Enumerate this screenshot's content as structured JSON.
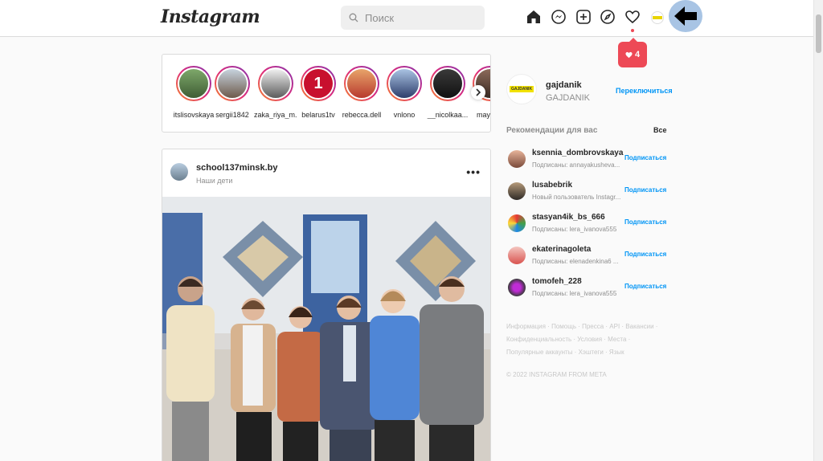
{
  "header": {
    "logo": "Instagram",
    "search_placeholder": "Поиск",
    "notifications": {
      "count": "4"
    }
  },
  "icons": {
    "home": "home-icon",
    "messenger": "messenger-icon",
    "new_post": "plus-square-icon",
    "explore": "compass-icon",
    "activity": "heart-icon",
    "arrow": "arrow-left-icon"
  },
  "stories": [
    {
      "name": "itslisovskaya"
    },
    {
      "name": "sergii1842"
    },
    {
      "name": "zaka_riya_m..."
    },
    {
      "name": "belarus1tv"
    },
    {
      "name": "rebecca.dell"
    },
    {
      "name": "vnlono"
    },
    {
      "name": "__nicolkaa..."
    },
    {
      "name": "mayos..."
    }
  ],
  "post": {
    "username": "school137minsk.by",
    "location": "Наши дети",
    "more": "•••"
  },
  "sidebar": {
    "me": {
      "username": "gajdanik",
      "full_name": "GAJDANIK",
      "avatar_text": "GAJDANIK",
      "switch_label": "Переключиться"
    },
    "suggestions_title": "Рекомендации для вас",
    "see_all": "Все",
    "suggestions": [
      {
        "username": "ksennia_dombrovskaya",
        "sub": "Подписаны: annayakusheva...",
        "follow": "Подписаться"
      },
      {
        "username": "lusabebrik",
        "sub": "Новый пользователь Instagr...",
        "follow": "Подписаться"
      },
      {
        "username": "stasyan4ik_bs_666",
        "sub": "Подписаны: lera_ivanova555",
        "follow": "Подписаться"
      },
      {
        "username": "ekaterinagoleta",
        "sub": "Подписаны: elenadenkina6 ...",
        "follow": "Подписаться"
      },
      {
        "username": "tomofeh_228",
        "sub": "Подписаны: lera_ivanova555",
        "follow": "Подписаться"
      }
    ],
    "footer_links": "Информация · Помощь · Пресса · API · Вакансии · Конфиденциальность · Условия · Места · Популярные аккаунты · Хэштеги · Язык",
    "copyright": "© 2022 INSTAGRAM FROM META"
  },
  "colors": {
    "accent": "#0095f6",
    "notification": "#ed4956",
    "border": "#dbdbdb",
    "background": "#fafafa"
  }
}
